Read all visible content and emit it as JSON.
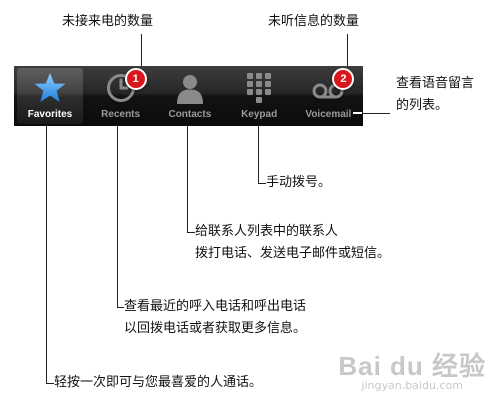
{
  "tabbar": {
    "tabs": [
      {
        "label": "Favorites",
        "icon": "star-icon",
        "badge": "",
        "active": true
      },
      {
        "label": "Recents",
        "icon": "clock-icon",
        "badge": "1",
        "active": false
      },
      {
        "label": "Contacts",
        "icon": "person-icon",
        "badge": "",
        "active": false
      },
      {
        "label": "Keypad",
        "icon": "keypad-icon",
        "badge": "",
        "active": false
      },
      {
        "label": "Voicemail",
        "icon": "voicemail-icon",
        "badge": "2",
        "active": false
      }
    ]
  },
  "callouts": {
    "missed_calls": "未接来电的数量",
    "unheard_messages": "未听信息的数量",
    "voicemail_line1": "查看语音留言",
    "voicemail_line2": "的列表。",
    "keypad": "手动拨号。",
    "contacts_line1": "给联系人列表中的联系人",
    "contacts_line2": "拨打电话、发送电子邮件或短信。",
    "recents_line1": "查看最近的呼入电话和呼出电话",
    "recents_line2": "以回拨电话或者获取更多信息。",
    "favorites": "轻按一次即可与您最喜爱的人通话。"
  },
  "watermark": {
    "brand": "Bai du 经验",
    "url": "jingyan.baidu.com"
  },
  "colors": {
    "badge": "#d8161b",
    "star": "#4aa3ff",
    "tabbar": "#1a1a1a"
  }
}
